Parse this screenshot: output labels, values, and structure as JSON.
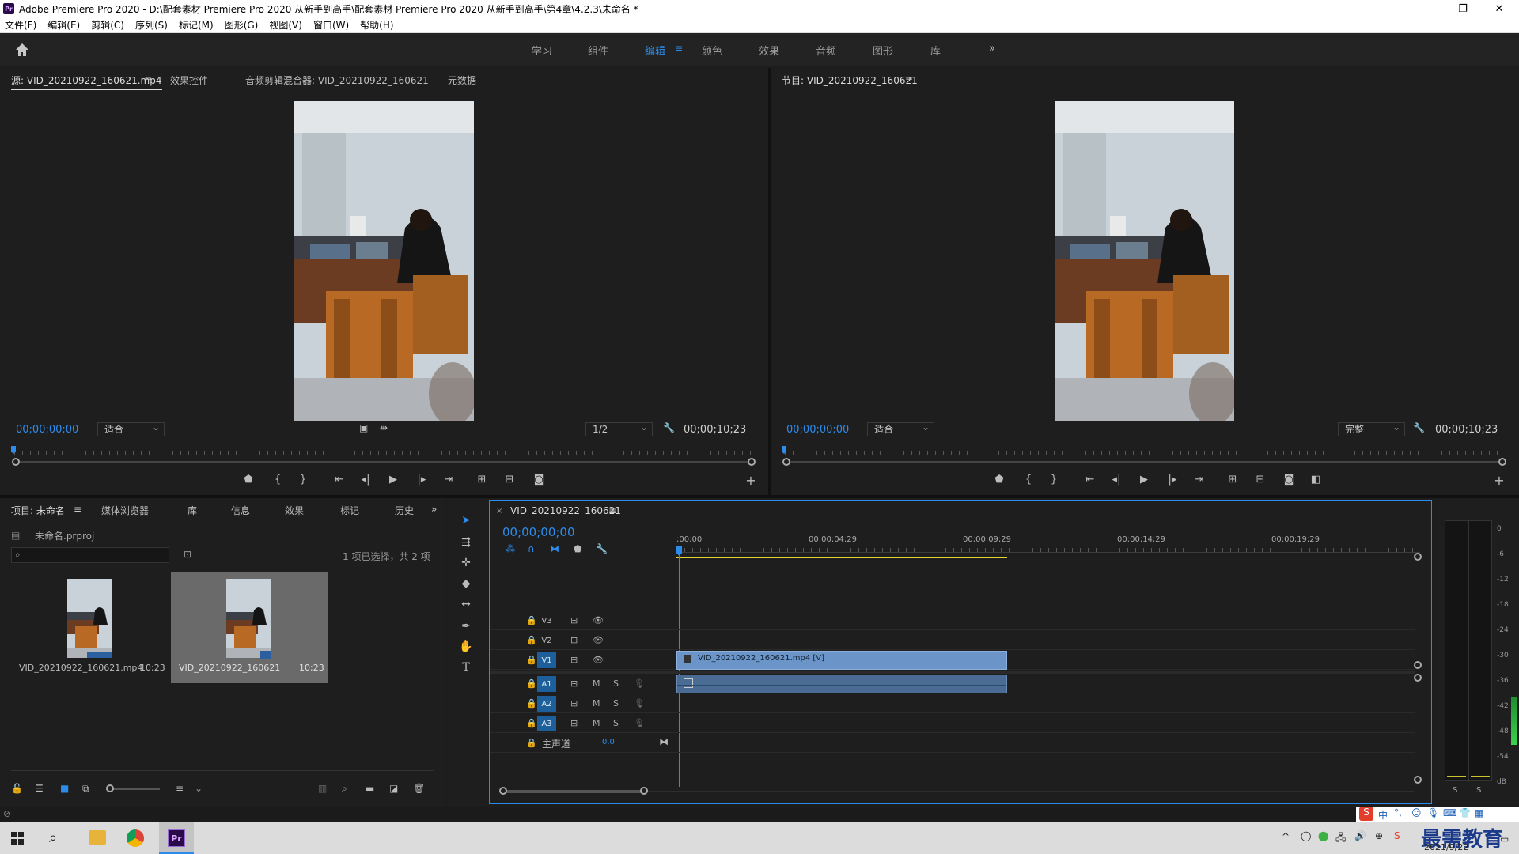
{
  "window": {
    "title": "Adobe Premiere Pro 2020 - D:\\配套素材 Premiere Pro 2020 从新手到高手\\配套素材 Premiere Pro 2020 从新手到高手\\第4章\\4.2.3\\未命名 *",
    "logo": "Pr"
  },
  "menu": [
    "文件(F)",
    "编辑(E)",
    "剪辑(C)",
    "序列(S)",
    "标记(M)",
    "图形(G)",
    "视图(V)",
    "窗口(W)",
    "帮助(H)"
  ],
  "workspaces": [
    "学习",
    "组件",
    "编辑",
    "颜色",
    "效果",
    "音频",
    "图形",
    "库"
  ],
  "active_workspace": "编辑",
  "source_monitor": {
    "tabs": [
      "源: VID_20210922_160621.mp4",
      "效果控件",
      "音频剪辑混合器: VID_20210922_160621",
      "元数据"
    ],
    "timecode": "00;00;00;00",
    "fit": "适合",
    "resolution": "1/2",
    "duration": "00;00;10;23"
  },
  "program_monitor": {
    "tab": "节目: VID_20210922_160621",
    "timecode": "00;00;00;00",
    "fit": "适合",
    "quality": "完整",
    "duration": "00;00;10;23"
  },
  "project_panel": {
    "tabs": [
      "项目: 未命名",
      "媒体浏览器",
      "库",
      "信息",
      "效果",
      "标记",
      "历史"
    ],
    "project_file": "未命名.prproj",
    "selection_status": "1 项已选择，共 2 项",
    "search_placeholder": "",
    "items": [
      {
        "name": "VID_20210922_160621.mp4",
        "duration": "10;23"
      },
      {
        "name": "VID_20210922_160621",
        "duration": "10;23"
      }
    ]
  },
  "timeline": {
    "sequence_tab": "VID_20210922_160621",
    "timecode": "00;00;00;00",
    "ruler_labels": [
      ";00;00",
      "00;00;04;29",
      "00;00;09;29",
      "00;00;14;29",
      "00;00;19;29"
    ],
    "video_tracks": [
      "V3",
      "V2",
      "V1"
    ],
    "audio_tracks": [
      "A1",
      "A2",
      "A3"
    ],
    "master_label": "主声道",
    "master_value": "0.0",
    "clip_label": "VID_20210922_160621.mp4 [V]",
    "mute_label": "M",
    "solo_label": "S"
  },
  "audio_meter": {
    "scale": [
      "0",
      "-6",
      "-12",
      "-18",
      "-24",
      "-30",
      "-36",
      "-42",
      "-48",
      "-54",
      "dB"
    ],
    "solo_labels": [
      "S",
      "S"
    ]
  },
  "taskbar": {
    "date": "2021/9/22",
    "watermark": "最需教育",
    "ime": "中"
  },
  "colors": {
    "accent": "#2d8ceb",
    "clip_video": "#6b95c9",
    "clip_audio": "#4a6c94",
    "work_area": "#e5d531"
  }
}
